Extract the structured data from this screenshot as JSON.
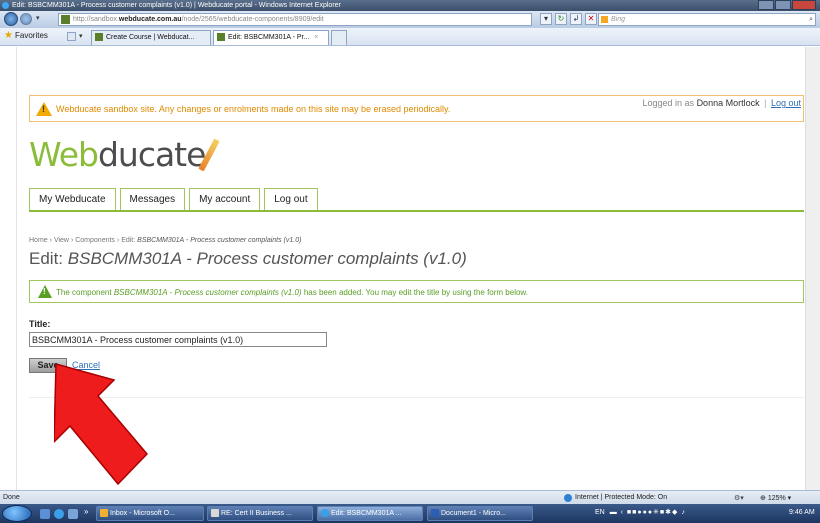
{
  "browser": {
    "window_title": "Edit: BSBCMM301A - Process customer complaints (v1.0) | Webducate portal - Windows Internet Explorer",
    "url_prefix": "http://sandbox.",
    "url_domain": "webducate.com.au",
    "url_path": "/node/2565/webducate-components/8909/edit",
    "search_placeholder": "Bing",
    "favorites_label": "Favorites",
    "tabs": [
      {
        "label": "Create Course | Webducat..."
      },
      {
        "label": "Edit: BSBCMM301A - Pr..."
      }
    ],
    "tab_close": "×"
  },
  "notice": {
    "sandbox_message": "Webducate sandbox site. Any changes or enrolments made on this site may be erased periodically.",
    "logged_in_label": "Logged in as",
    "user_name": "Donna Mortlock",
    "separator": "|",
    "logout_label": "Log out"
  },
  "logo": {
    "part1": "Web",
    "part2": "ducate"
  },
  "menu": {
    "items": [
      {
        "label": "My Webducate"
      },
      {
        "label": "Messages"
      },
      {
        "label": "My account"
      },
      {
        "label": "Log out"
      }
    ]
  },
  "breadcrumb": {
    "home": "Home",
    "view": "View",
    "components": "Components",
    "sep": "›",
    "current_prefix": "Edit:",
    "current": "BSBCMM301A - Process customer complaints (v1.0)"
  },
  "page_title": {
    "prefix": "Edit:",
    "name": "BSBCMM301A - Process customer complaints (v1.0)"
  },
  "status_message": {
    "before": "The component",
    "name": "BSBCMM301A - Process customer complaints (v1.0)",
    "after": "has been added. You may edit the title by using the form below."
  },
  "form": {
    "title_label": "Title:",
    "title_value": "BSBCMM301A - Process customer complaints (v1.0)",
    "save_label": "Save",
    "cancel_label": "Cancel"
  },
  "statusbar": {
    "left": "Done",
    "zone": "Internet | Protected Mode: On",
    "zoom": "125%"
  },
  "taskbar": {
    "buttons": [
      {
        "label": "Inbox - Microsoft O..."
      },
      {
        "label": "RE: Cert II Business ..."
      },
      {
        "label": "Edit: BSBCMM301A ..."
      },
      {
        "label": "Document1 - Micro..."
      }
    ],
    "lang": "EN",
    "time": "9:46 AM"
  }
}
